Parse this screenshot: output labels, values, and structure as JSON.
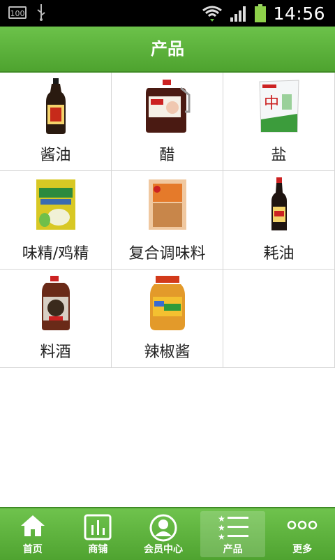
{
  "status_bar": {
    "battery_small": "100",
    "time": "14:56"
  },
  "header": {
    "title": "产品"
  },
  "products": [
    {
      "label": "酱油",
      "icon": "soy-sauce-bottle"
    },
    {
      "label": "醋",
      "icon": "vinegar-jug"
    },
    {
      "label": "盐",
      "icon": "salt-bag"
    },
    {
      "label": "味精/鸡精",
      "icon": "msg-packet"
    },
    {
      "label": "复合调味料",
      "icon": "seasoning-pack"
    },
    {
      "label": "耗油",
      "icon": "oyster-sauce-bottle"
    },
    {
      "label": "料酒",
      "icon": "cooking-wine-jug"
    },
    {
      "label": "辣椒酱",
      "icon": "chili-sauce-jar"
    }
  ],
  "nav": [
    {
      "label": "首页",
      "icon": "home-icon"
    },
    {
      "label": "商铺",
      "icon": "shop-chart-icon"
    },
    {
      "label": "会员中心",
      "icon": "member-icon"
    },
    {
      "label": "产品",
      "icon": "list-star-icon",
      "active": true
    },
    {
      "label": "更多",
      "icon": "more-dots-icon"
    }
  ],
  "colors": {
    "header": "#5cb33c",
    "nav": "#5cb33c"
  }
}
